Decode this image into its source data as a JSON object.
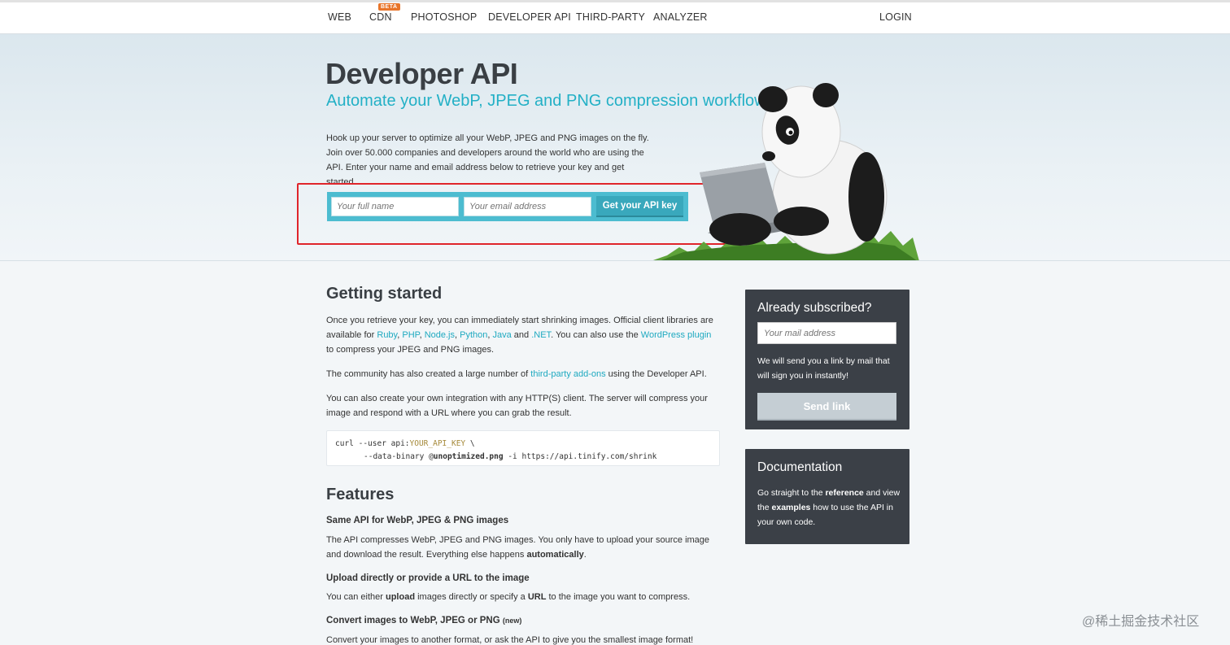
{
  "nav": {
    "items": [
      "WEB",
      "CDN",
      "PHOTOSHOP",
      "DEVELOPER API",
      "THIRD-PARTY",
      "ANALYZER"
    ],
    "cdn_badge": "BETA",
    "login": "LOGIN"
  },
  "hero": {
    "title": "Developer API",
    "subtitle": "Automate your WebP, JPEG and PNG compression workflow",
    "description": "Hook up your server to optimize all your WebP, JPEG and PNG images on the fly. Join over 50.000 companies and developers around the world who are using the API. Enter your name and email address below to retrieve your key and get started.",
    "name_placeholder": "Your full name",
    "email_placeholder": "Your email address",
    "cta": "Get your API key"
  },
  "getting_started": {
    "title": "Getting started",
    "p1_a": "Once you retrieve your key, you can immediately start shrinking images. Official client libraries are available for ",
    "libs": [
      "Ruby",
      "PHP",
      "Node.js",
      "Python",
      "Java",
      ".NET"
    ],
    "p1_b": ". You can also use the ",
    "wp_link": "WordPress plugin",
    "p1_c": " to compress your JPEG and PNG images.",
    "p2_a": "The community has also created a large number of ",
    "p2_link": "third-party add-ons",
    "p2_b": " using the Developer API.",
    "p3": "You can also create your own integration with any HTTP(S) client. The server will compress your image and respond with a URL where you can grab the result.",
    "code_line1_a": "curl --user api:",
    "code_line1_key": "YOUR_API_KEY",
    "code_line1_b": " \\",
    "code_line2_a": "--data-binary @",
    "code_line2_file": "unoptimized.png",
    "code_line2_b": " -i https://api.tinify.com/shrink"
  },
  "features": {
    "title": "Features",
    "f1_title": "Same API for WebP, JPEG & PNG images",
    "f1_a": "The API compresses WebP, JPEG and PNG images. You only have to upload your source image and download the result. Everything else happens ",
    "f1_bold": "automatically",
    "f1_b": ".",
    "f2_title": "Upload directly or provide a URL to the image",
    "f2_a": "You can either ",
    "f2_bold1": "upload",
    "f2_b": " images directly or specify a ",
    "f2_bold2": "URL",
    "f2_c": " to the image you want to compress.",
    "f3_title": "Convert images to WebP, JPEG or PNG",
    "f3_new": "(new)",
    "f3_text": "Convert your images to another format, or ask the API to give you the smallest image format! Images"
  },
  "subscribed": {
    "title": "Already subscribed?",
    "placeholder": "Your mail address",
    "text": "We will send you a link by mail that will sign you in instantly!",
    "button": "Send link"
  },
  "docs": {
    "title": "Documentation",
    "a": "Go straight to the ",
    "bold1": "reference",
    "b": " and view the ",
    "bold2": "examples",
    "c": " how to use the API in your own code."
  },
  "watermark": "@稀土掘金技术社区"
}
